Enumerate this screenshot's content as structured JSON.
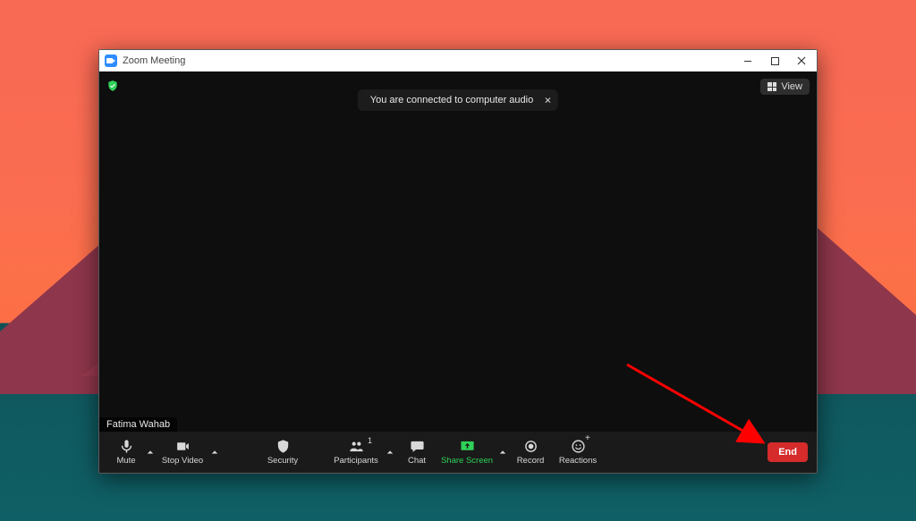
{
  "window": {
    "title": "Zoom Meeting"
  },
  "topbar": {
    "view_label": "View"
  },
  "toast": {
    "message": "You are connected to computer audio"
  },
  "participant": {
    "name": "Fatima Wahab"
  },
  "toolbar": {
    "mute": "Mute",
    "stop_video": "Stop Video",
    "security": "Security",
    "participants": "Participants",
    "participants_count": "1",
    "chat": "Chat",
    "share_screen": "Share Screen",
    "record": "Record",
    "reactions": "Reactions",
    "end": "End"
  }
}
